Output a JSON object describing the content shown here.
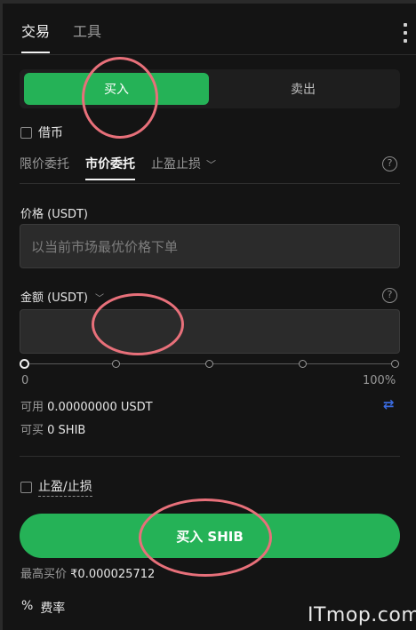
{
  "tabs": [
    "交易",
    "工具"
  ],
  "side": {
    "buy_label": "买入",
    "sell_label": "卖出"
  },
  "margin": {
    "label": "借币"
  },
  "order_types": [
    "限价委托",
    "市价委托",
    "止盈止损"
  ],
  "price": {
    "label": "价格 (USDT)",
    "placeholder": "以当前市场最优价格下单"
  },
  "amount": {
    "label": "金额 (USDT)",
    "value": ""
  },
  "slider": {
    "min_label": "0",
    "max_label": "100%",
    "percent": 0
  },
  "available": {
    "label": "可用",
    "value": "0.00000000 USDT"
  },
  "can_buy": {
    "label": "可买",
    "value": "0 SHIB"
  },
  "tpsl": {
    "label": "止盈/止损"
  },
  "submit": {
    "label": "买入 SHIB"
  },
  "max_price": {
    "label": "最高买价",
    "value": "₹0.000025712"
  },
  "fee": {
    "icon": "%",
    "label": "费率"
  },
  "watermark": "ITmop.com",
  "colors": {
    "buy_green": "#25b257",
    "annotation_red": "#e8707a",
    "swap_blue": "#3a6be0"
  }
}
